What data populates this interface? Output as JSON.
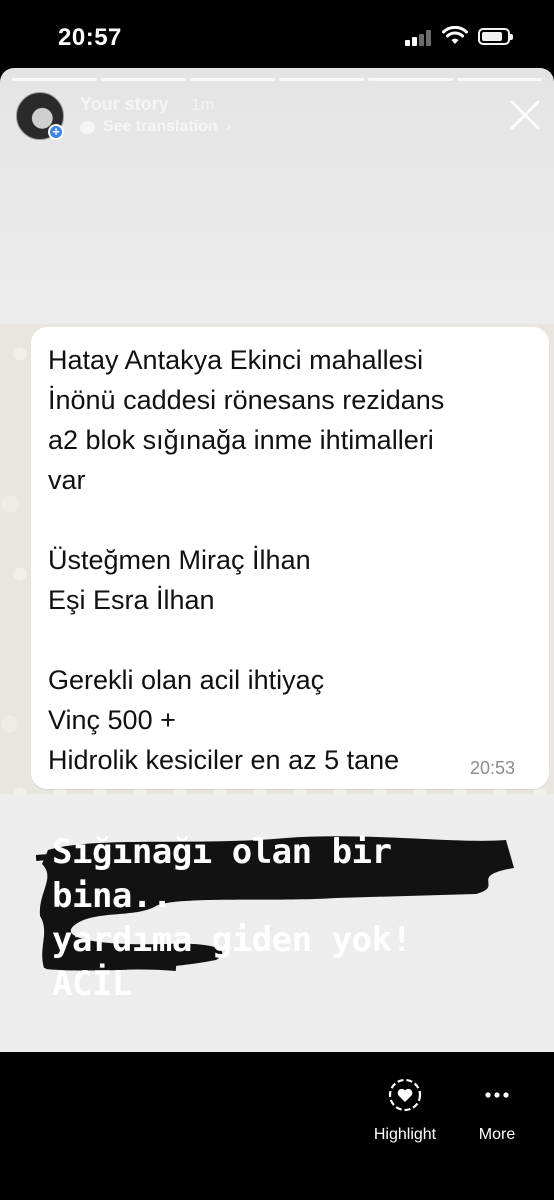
{
  "status_bar": {
    "time": "20:57",
    "signal_icon": "cellular-signal-icon",
    "wifi_icon": "wifi-icon",
    "battery_icon": "battery-icon"
  },
  "story": {
    "owner": "Your story",
    "time_ago": "1m",
    "translate_label": "See translation",
    "translate_chevron": "›",
    "avatar_badge": "+",
    "close_icon": "close-icon",
    "progress_segments": 6
  },
  "chat": {
    "message": "Hatay Antakya Ekinci mahallesi\nİnönü caddesi rönesans rezidans\na2 blok sığınağa inme ihtimalleri\nvar\n\nÜsteğmen Miraç İlhan\nEşi Esra İlhan\n\nGerekli olan acil ihtiyaç\nVinç 500 +\nHidrolik kesiciler en az 5 tane",
    "timestamp": "20:53"
  },
  "caption": {
    "text": "Sığınağı olan bir bina..\nyardıma giden yok!\nACİL",
    "brush_color": "#111111"
  },
  "actions": {
    "highlight_label": "Highlight",
    "more_label": "More",
    "highlight_icon": "heart-highlight-icon",
    "more_icon": "more-dots-icon"
  },
  "colors": {
    "background": "#000000",
    "bubble": "#ffffff",
    "avatar_badge": "#3b82f6"
  }
}
